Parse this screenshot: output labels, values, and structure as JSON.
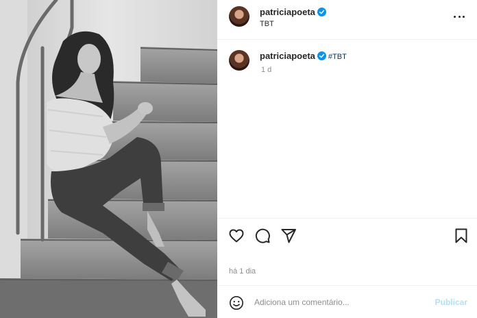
{
  "post": {
    "photo_icon": "photo-bw-woman-on-stairs",
    "author": "patriciapoeta",
    "verified": true,
    "header_subtitle": "TBT",
    "caption": {
      "username": "patriciapoeta",
      "hashtag": "#TBT",
      "time_ago": "1 d"
    },
    "date_text": "há 1 dia"
  },
  "actions": {
    "like_icon": "heart-icon",
    "comment_icon": "comment-icon",
    "share_icon": "share-icon",
    "save_icon": "bookmark-icon"
  },
  "comment_box": {
    "placeholder": "Adiciona um comentário...",
    "value": "",
    "publish_label": "Publicar"
  },
  "colors": {
    "verified": "#0095f6",
    "link": "#00376b",
    "muted": "#8e8e8e",
    "publish_disabled": "#b2dffc"
  }
}
